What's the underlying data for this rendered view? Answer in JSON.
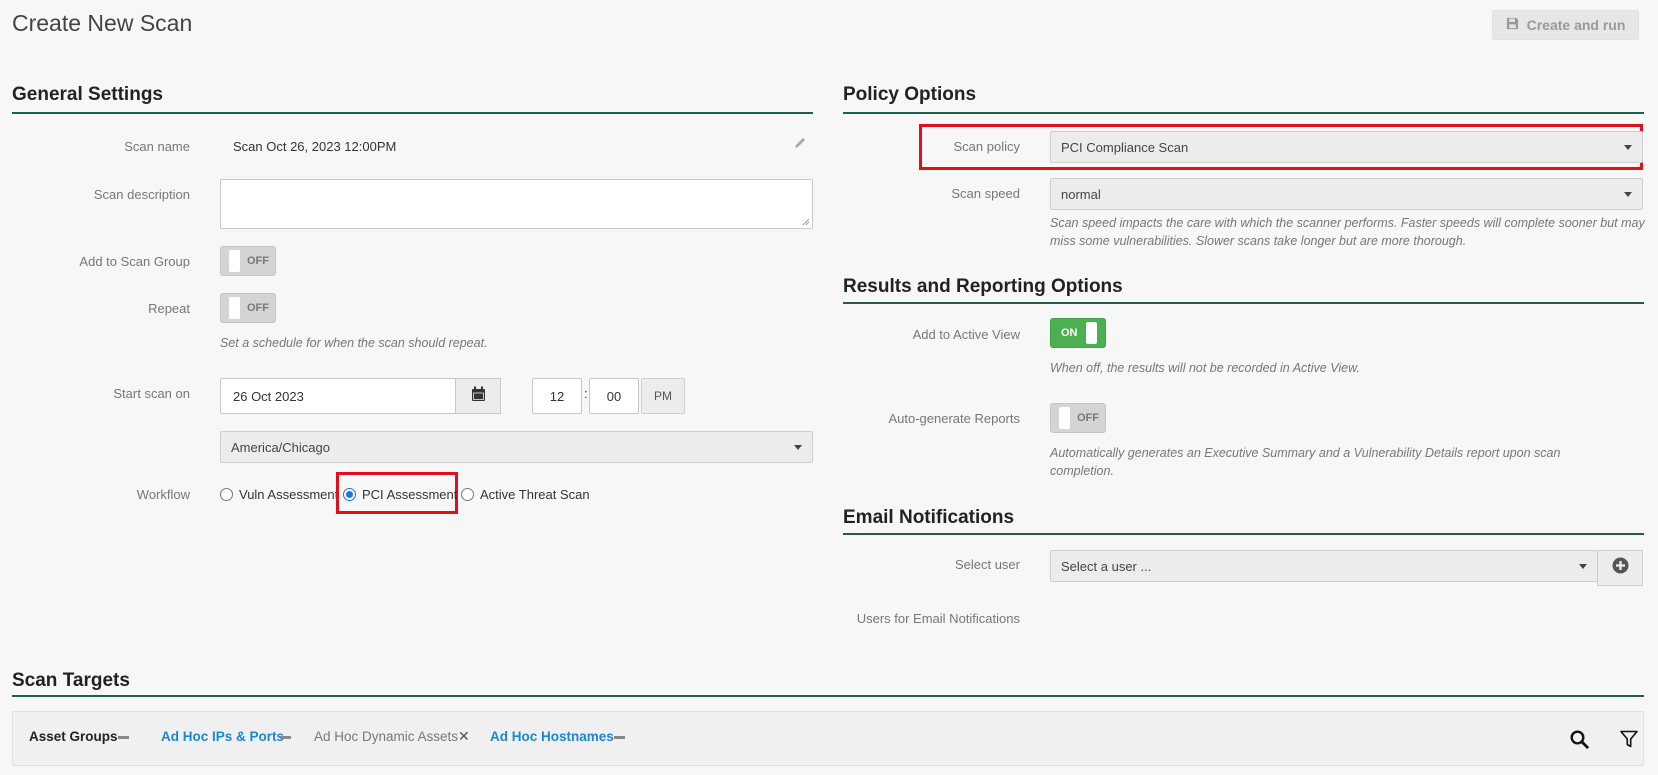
{
  "header": {
    "title": "Create New Scan",
    "create_run_label": "Create and run"
  },
  "general": {
    "title": "General Settings",
    "scan_name_label": "Scan name",
    "scan_name_value": "Scan Oct 26, 2023 12:00PM",
    "scan_description_label": "Scan description",
    "scan_description_value": "",
    "add_group_label": "Add to Scan Group",
    "add_group_toggle": "OFF",
    "repeat_label": "Repeat",
    "repeat_toggle": "OFF",
    "repeat_help": "Set a schedule for when the scan should repeat.",
    "start_label": "Start scan on",
    "start_date": "26 Oct 2023",
    "hour": "12",
    "minute": "00",
    "ampm": "PM",
    "timezone": "America/Chicago",
    "workflow_label": "Workflow",
    "workflow_options": [
      "Vuln Assessment",
      "PCI Assessment",
      "Active Threat Scan"
    ],
    "workflow_selected": "PCI Assessment"
  },
  "policy": {
    "title": "Policy Options",
    "scan_policy_label": "Scan policy",
    "scan_policy_value": "PCI Compliance Scan",
    "scan_speed_label": "Scan speed",
    "scan_speed_value": "normal",
    "scan_speed_help": "Scan speed impacts the care with which the scanner performs. Faster speeds will complete sooner but may miss some vulnerabilities. Slower scans take longer but are more thorough."
  },
  "results": {
    "title": "Results and Reporting Options",
    "active_view_label": "Add to Active View",
    "active_view_toggle": "ON",
    "active_view_help": "When off, the results will not be recorded in Active View.",
    "auto_reports_label": "Auto-generate Reports",
    "auto_reports_toggle": "OFF",
    "auto_reports_help": "Automatically generates an Executive Summary and a Vulnerability Details report upon scan completion."
  },
  "email": {
    "title": "Email Notifications",
    "select_user_label": "Select user",
    "select_user_placeholder": "Select a user ...",
    "users_label": "Users for Email Notifications"
  },
  "targets": {
    "title": "Scan Targets",
    "tabs": [
      {
        "label": "Asset Groups",
        "state": "active"
      },
      {
        "label": "Ad Hoc IPs & Ports",
        "state": "link"
      },
      {
        "label": "Ad Hoc Dynamic Assets",
        "state": "disabled"
      },
      {
        "label": "Ad Hoc Hostnames",
        "state": "link"
      }
    ]
  },
  "colors": {
    "accent_line": "#1f5e4c",
    "link_blue": "#1a87d6",
    "highlight_red": "#e0101a",
    "toggle_on": "#4caf50"
  },
  "icons": [
    "save-icon",
    "pencil-icon",
    "calendar-icon",
    "plus-circle-icon",
    "search-icon",
    "filter-icon",
    "minus-icon",
    "close-icon"
  ]
}
